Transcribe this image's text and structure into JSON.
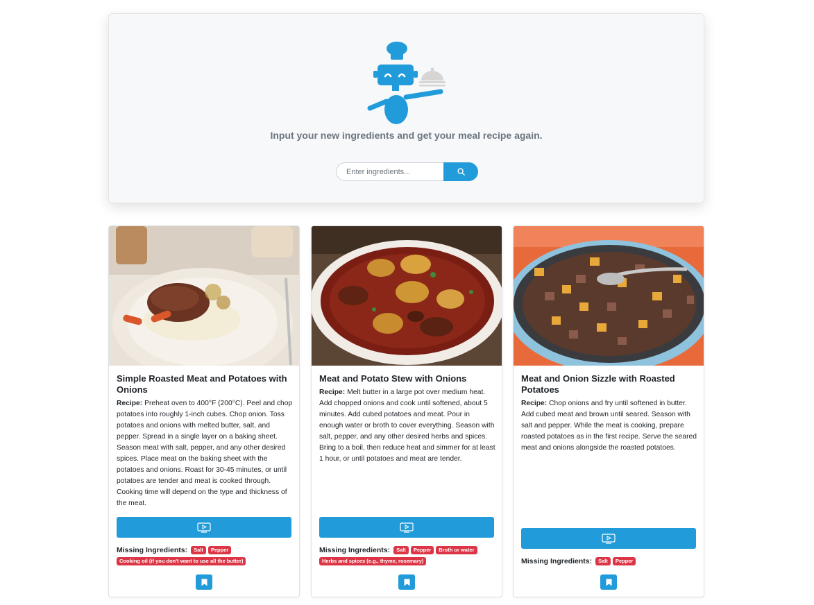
{
  "hero": {
    "tagline": "Input your new ingredients and get your meal recipe again.",
    "search_placeholder": "Enter ingredients...",
    "search_icon": "search-icon",
    "logo_icon": "chef-robot-logo"
  },
  "colors": {
    "accent": "#219bd9",
    "missing_badge": "#dc3545",
    "hero_bg": "#f7f8fa"
  },
  "recipe_label": "Recipe:",
  "missing_label": "Missing Ingredients:",
  "cards": [
    {
      "title": "Simple Roasted Meat and Potatoes with Onions",
      "recipe": "Preheat oven to 400°F (200°C). Peel and chop potatoes into roughly 1-inch cubes. Chop onion. Toss potatoes and onions with melted butter, salt, and pepper. Spread in a single layer on a baking sheet. Season meat with salt, pepper, and any other desired spices. Place meat on the baking sheet with the potatoes and onions. Roast for 30-45 minutes, or until potatoes are tender and meat is cooked through. Cooking time will depend on the type and thickness of the meat.",
      "missing": [
        "Salt",
        "Pepper",
        "Cooking oil (if you don't want to use all the butter)"
      ]
    },
    {
      "title": "Meat and Potato Stew with Onions",
      "recipe": "Melt butter in a large pot over medium heat. Add chopped onions and cook until softened, about 5 minutes. Add cubed potatoes and meat. Pour in enough water or broth to cover everything. Season with salt, pepper, and any other desired herbs and spices. Bring to a boil, then reduce heat and simmer for at least 1 hour, or until potatoes and meat are tender.",
      "missing": [
        "Salt",
        "Pepper",
        "Broth or water",
        "Herbs and spices (e.g., thyme, rosemary)"
      ]
    },
    {
      "title": "Meat and Onion Sizzle with Roasted Potatoes",
      "recipe": "Chop onions and fry until softened in butter. Add cubed meat and brown until seared. Season with salt and pepper. While the meat is cooking, prepare roasted potatoes as in the first recipe. Serve the seared meat and onions alongside the roasted potatoes.",
      "missing": [
        "Salt",
        "Pepper"
      ]
    }
  ],
  "icons": {
    "video": "video-play-icon",
    "bookmark": "bookmark-icon"
  }
}
